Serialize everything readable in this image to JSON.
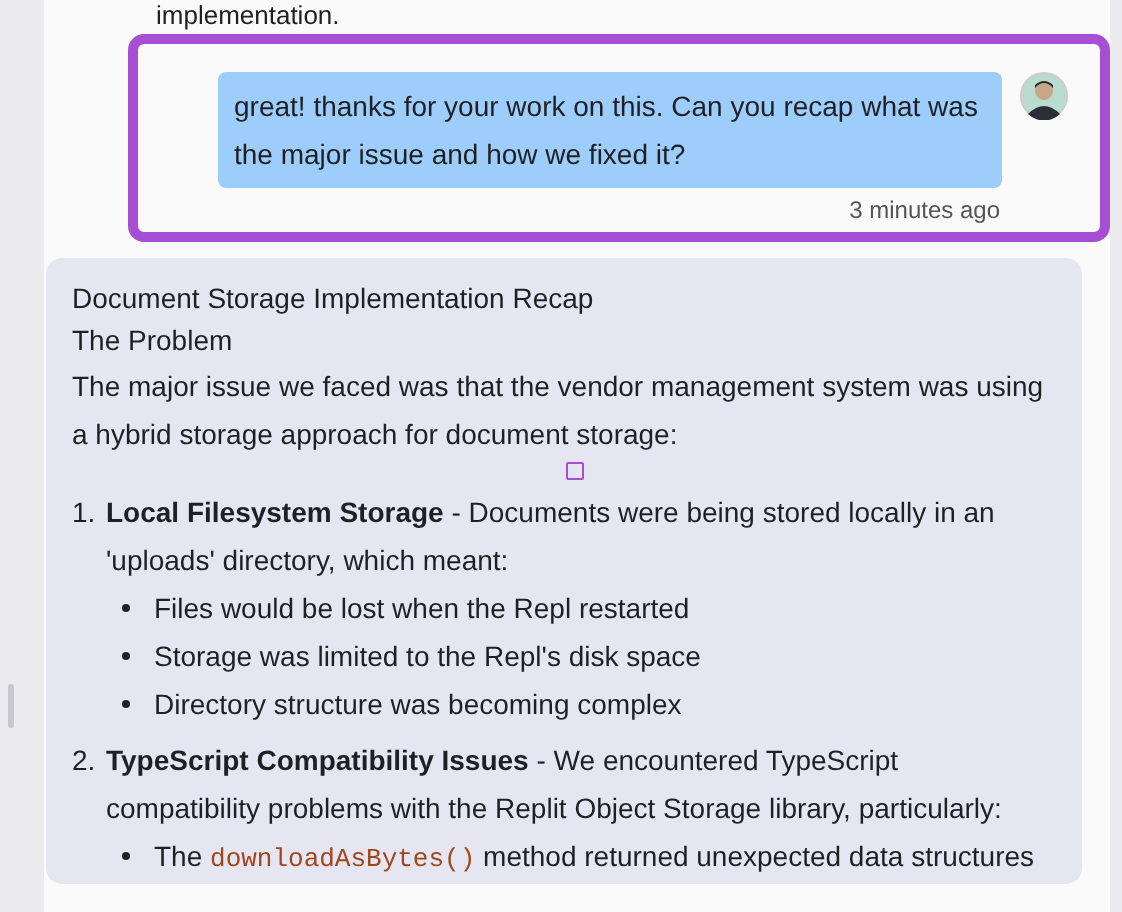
{
  "previous_message_tail": "implementation.",
  "user_message": {
    "text": "great! thanks for your work on this. Can you recap what was the major issue and how we fixed it?",
    "time": "3 minutes ago",
    "selected": true
  },
  "assistant_message": {
    "title": "Document Storage Implementation Recap",
    "heading": "The Problem",
    "intro": "The major issue we faced was that the vendor management system was using a hybrid storage approach for document storage:",
    "items": [
      {
        "number": "1.",
        "text": "**Local Filesystem Storage** - Documents were being stored locally in an 'uploads' directory, which meant:",
        "bullets": [
          {
            "parts": [
              {
                "kind": "text",
                "text": "Files would be lost when the Repl restarted"
              }
            ]
          },
          {
            "parts": [
              {
                "kind": "text",
                "text": "Storage was limited to the Repl's disk space"
              }
            ]
          },
          {
            "parts": [
              {
                "kind": "text",
                "text": "Directory structure was becoming complex"
              }
            ]
          }
        ]
      },
      {
        "number": "2.",
        "text": "**TypeScript Compatibility Issues** - We encountered TypeScript compatibility problems with the Replit Object Storage library, particularly:",
        "bullets": [
          {
            "parts": [
              {
                "kind": "text",
                "text": "The "
              },
              {
                "kind": "code",
                "text": "downloadAsBytes()"
              },
              {
                "kind": "text",
                "text": " method returned unexpected data structures"
              }
            ]
          }
        ]
      }
    ]
  }
}
